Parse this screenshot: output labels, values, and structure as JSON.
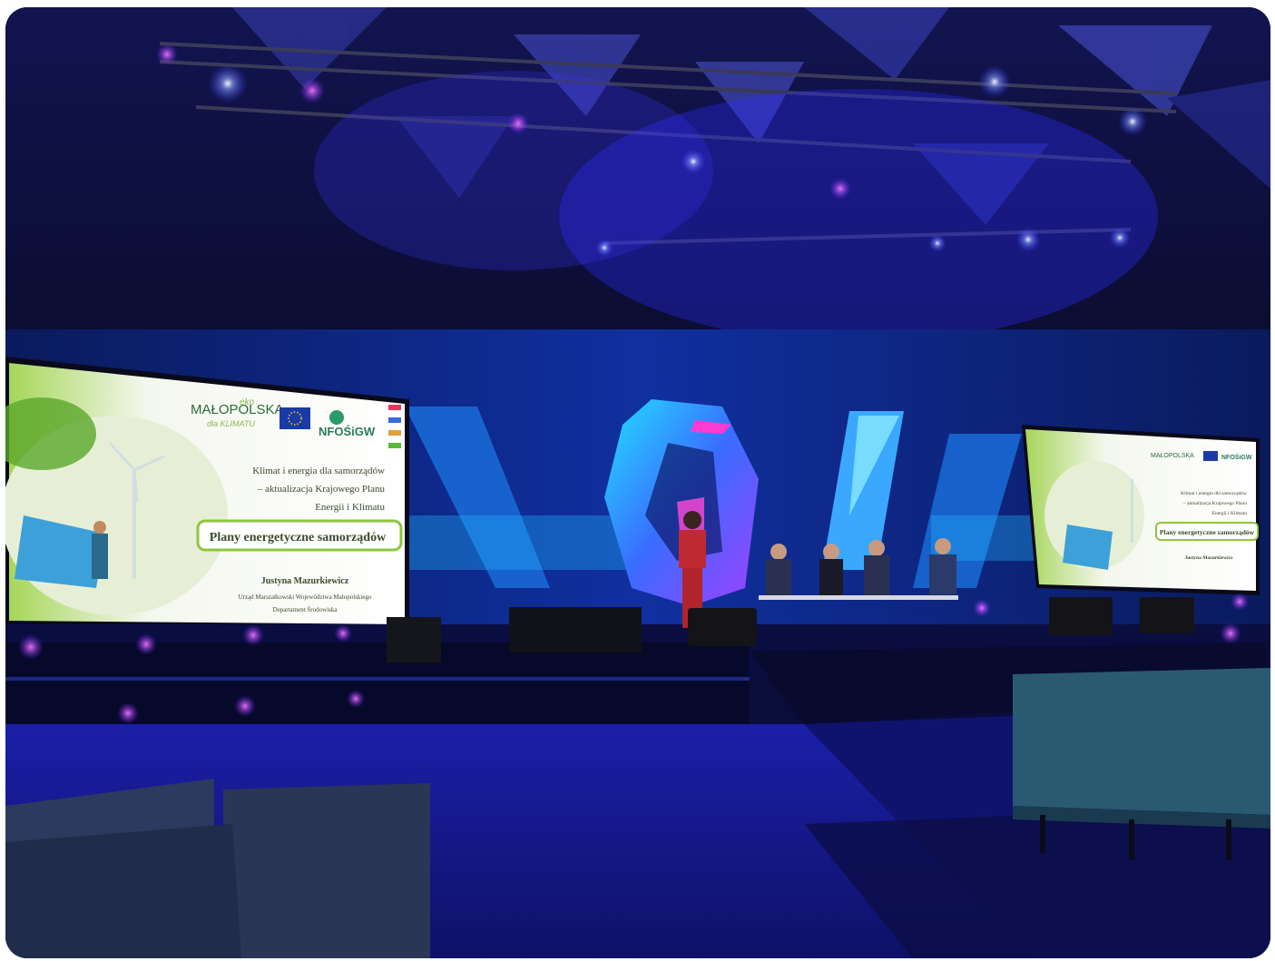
{
  "photo": {
    "description_free": true
  },
  "left_screen": {
    "logo_malopolska_prefix": "eko",
    "logo_malopolska": "MAŁOPOLSKA",
    "logo_malopolska_sub": "dla KLIMATU",
    "logo_nfosigw": "NFOŚiGW",
    "title_line1": "Klimat i energia dla samorządów",
    "title_line2": "– aktualizacja Krajowego Planu",
    "title_line3": "Energii i Klimatu",
    "banner": "Plany energetyczne samorządów",
    "speaker_name": "Justyna Mazurkiewicz",
    "speaker_org": "Urząd Marszałkowski Województwa Małopolskiego",
    "speaker_dept": "Departament Środowiska"
  },
  "right_screen": {
    "logo_malopolska": "MAŁOPOLSKA",
    "logo_nfosigw": "NFOŚiGW",
    "title_line1": "Klimat i energia dla samorządów",
    "title_line2": "– aktualizacja Krajowego Planu",
    "title_line3": "Energii i Klimatu",
    "banner": "Plany energetyczne samorządów",
    "speaker_name": "Justyna Mazurkiewicz"
  },
  "colors": {
    "stage_blue": "#1a1fb8",
    "ceiling": "#0d0f3a",
    "screen_green": "#8cc63f",
    "accent_cyan": "#29d3f0",
    "accent_magenta": "#d437c8"
  }
}
